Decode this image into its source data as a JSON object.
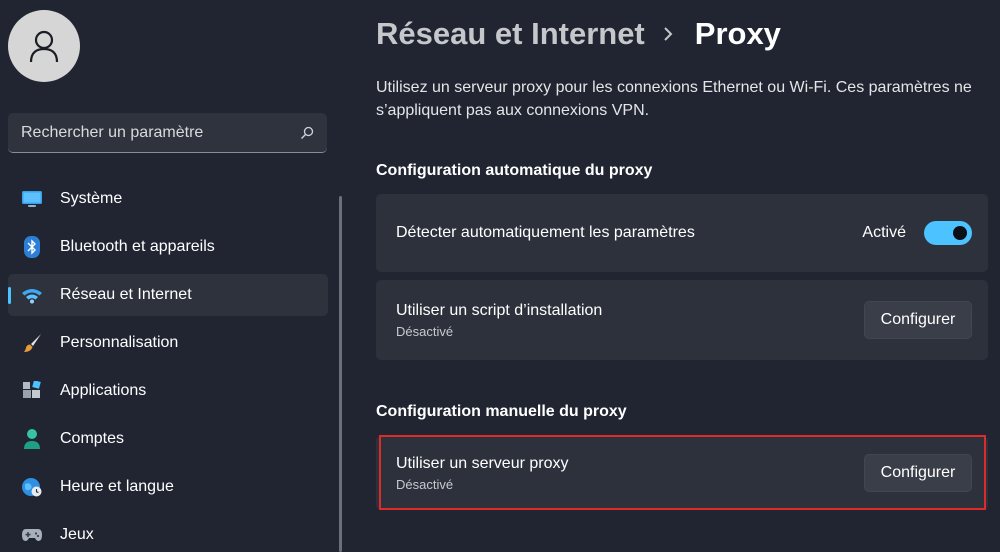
{
  "sidebar": {
    "search": {
      "placeholder": "Rechercher un paramètre"
    },
    "items": [
      {
        "label": "Système",
        "icon": "monitor-icon"
      },
      {
        "label": "Bluetooth et appareils",
        "icon": "bluetooth-icon"
      },
      {
        "label": "Réseau et Internet",
        "icon": "wifi-icon",
        "active": true
      },
      {
        "label": "Personnalisation",
        "icon": "brush-icon"
      },
      {
        "label": "Applications",
        "icon": "apps-icon"
      },
      {
        "label": "Comptes",
        "icon": "person-icon"
      },
      {
        "label": "Heure et langue",
        "icon": "globe-clock-icon"
      },
      {
        "label": "Jeux",
        "icon": "gamepad-icon"
      }
    ]
  },
  "header": {
    "parent": "Réseau et Internet",
    "current": "Proxy"
  },
  "description": "Utilisez un serveur proxy pour les connexions Ethernet ou Wi-Fi. Ces paramètres ne s’appliquent pas aux connexions VPN.",
  "auto_section": {
    "title": "Configuration automatique du proxy",
    "detect": {
      "label": "Détecter automatiquement les paramètres",
      "state": "Activé",
      "on": true
    },
    "script": {
      "label": "Utiliser un script d’installation",
      "status": "Désactivé",
      "button": "Configurer"
    }
  },
  "manual_section": {
    "title": "Configuration manuelle du proxy",
    "server": {
      "label": "Utiliser un serveur proxy",
      "status": "Désactivé",
      "button": "Configurer"
    }
  },
  "colors": {
    "accent": "#4cc2ff",
    "highlight": "#e02a2a",
    "background": "#202531",
    "card": "#2c313c"
  }
}
